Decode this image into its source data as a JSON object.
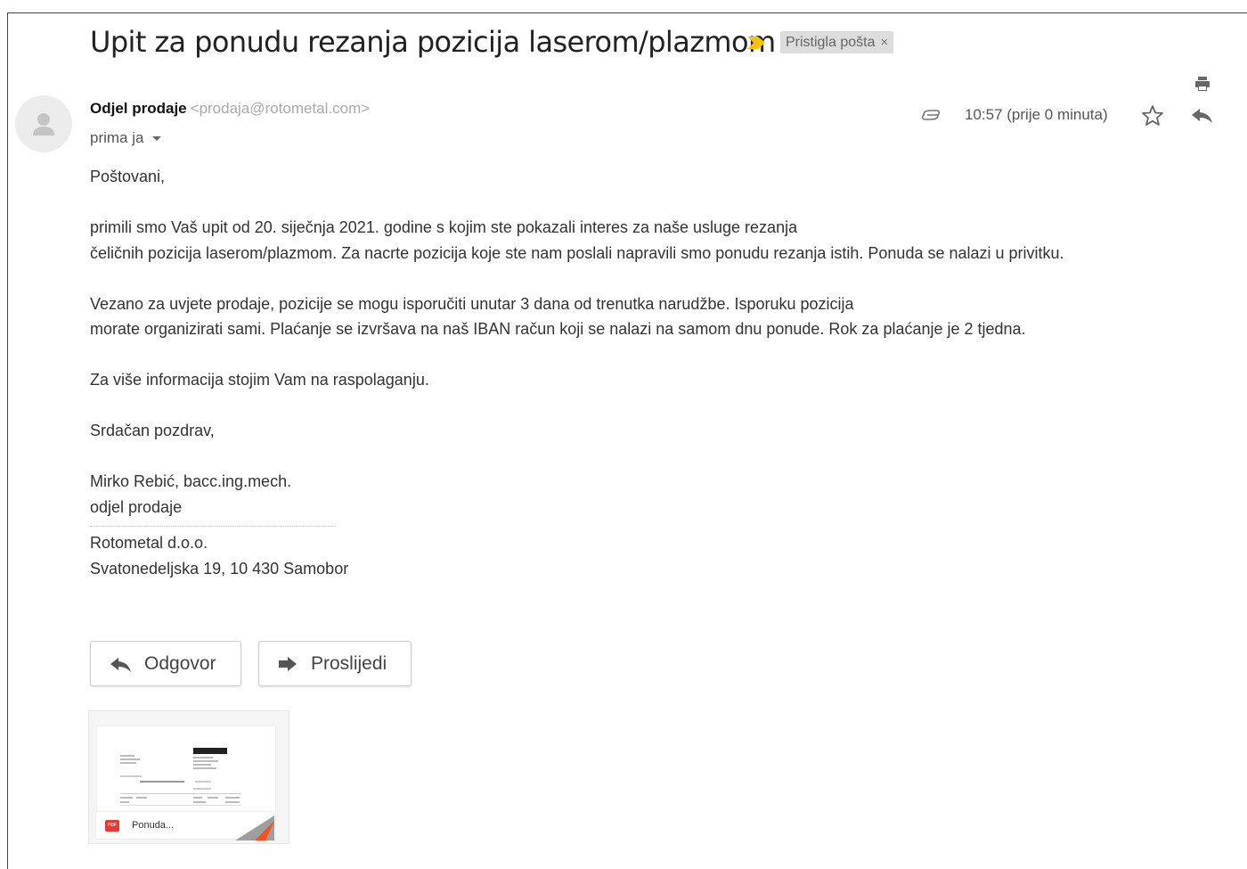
{
  "email": {
    "subject": "Upit za ponudu rezanja pozicija laserom/plazmom",
    "label": "Pristigla pošta",
    "label_remove": "×",
    "sender_name": "Odjel prodaje",
    "sender_email": "<prodaja@rotometal.com>",
    "recipient": "prima ja",
    "time": "10:57 (prije 0 minuta)",
    "body": {
      "greeting": "Poštovani,",
      "p1_line1": "primili smo Vaš upit od 20. siječnja 2021. godine s kojim ste pokazali interes za naše usluge rezanja",
      "p1_line2": "čeličnih pozicija laserom/plazmom. Za nacrte pozicija koje ste nam poslali napravili smo ponudu rezanja istih. Ponuda se nalazi u privitku.",
      "p2_line1": "Vezano za uvjete prodaje, pozicije se mogu isporučiti unutar 3 dana od trenutka narudžbe. Isporuku pozicija",
      "p2_line2": "morate organizirati sami. Plaćanje se izvršava na naš IBAN račun koji se nalazi na samom dnu ponude. Rok za plaćanje je 2 tjedna.",
      "p3": "Za više informacija stojim Vam na raspolaganju.",
      "closing": "Srdačan pozdrav,",
      "signature_name": "Mirko Rebić, bacc.ing.mech.",
      "signature_dept": "odjel prodaje",
      "company": "Rotometal d.o.o.",
      "address": "Svatonedeljska 19, 10 430 Samobor"
    }
  },
  "actions": {
    "reply": "Odgovor",
    "forward": "Proslijedi"
  },
  "attachment": {
    "type": "PDF",
    "name": "Ponuda..."
  },
  "icons": {
    "importance": "importance-marker-icon",
    "print": "print-icon",
    "attachment": "paperclip-icon",
    "star": "star-icon",
    "reply": "reply-icon",
    "forward": "forward-icon"
  },
  "colors": {
    "importance": "#f4c20d",
    "label_bg": "#dddddd",
    "pdf": "#e53935"
  }
}
